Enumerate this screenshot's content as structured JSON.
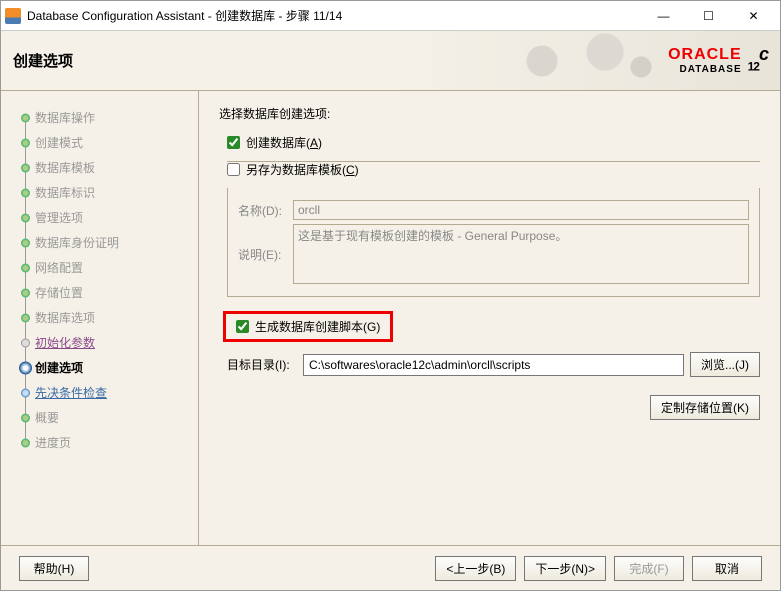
{
  "window": {
    "title": "Database Configuration Assistant - 创建数据库 - 步骤 11/14"
  },
  "header": {
    "title": "创建选项",
    "brand_red": "ORACLE",
    "brand_db": "DATABASE",
    "twelve": "12",
    "c": "c"
  },
  "sidebar": {
    "steps": [
      {
        "label": "数据库操作",
        "state": "done"
      },
      {
        "label": "创建模式",
        "state": "done"
      },
      {
        "label": "数据库模板",
        "state": "done"
      },
      {
        "label": "数据库标识",
        "state": "done"
      },
      {
        "label": "管理选项",
        "state": "done"
      },
      {
        "label": "数据库身份证明",
        "state": "done"
      },
      {
        "label": "网络配置",
        "state": "done"
      },
      {
        "label": "存储位置",
        "state": "done"
      },
      {
        "label": "数据库选项",
        "state": "done"
      },
      {
        "label": "初始化参数",
        "state": "link"
      },
      {
        "label": "创建选项",
        "state": "current"
      },
      {
        "label": "先决条件检查",
        "state": "future"
      },
      {
        "label": "概要",
        "state": "done"
      },
      {
        "label": "进度页",
        "state": "done"
      }
    ]
  },
  "main": {
    "section_title": "选择数据库创建选项:",
    "create_db": {
      "label_pre": "创建数据库(",
      "mnemonic": "A",
      "label_post": ")",
      "checked": true
    },
    "save_tmpl": {
      "label_pre": "另存为数据库模板(",
      "mnemonic": "C",
      "label_post": ")",
      "checked": false
    },
    "name_label": "名称(D):",
    "name_value": "orcll",
    "desc_label": "说明(E):",
    "desc_value": "这是基于现有模板创建的模板 - General Purpose。",
    "gen_script": {
      "label_pre": "生成数据库创建脚本(",
      "mnemonic": "G",
      "label_post": ")",
      "checked": true
    },
    "dir_label": "目标目录(I):",
    "dir_value": "C:\\softwares\\oracle12c\\admin\\orcll\\scripts",
    "browse_btn": "浏览...(J)",
    "custom_loc_btn": "定制存储位置(K)"
  },
  "footer": {
    "help": "帮助(H)",
    "back": "<上一步(B)",
    "next": "下一步(N)>",
    "finish": "完成(F)",
    "cancel": "取消"
  }
}
